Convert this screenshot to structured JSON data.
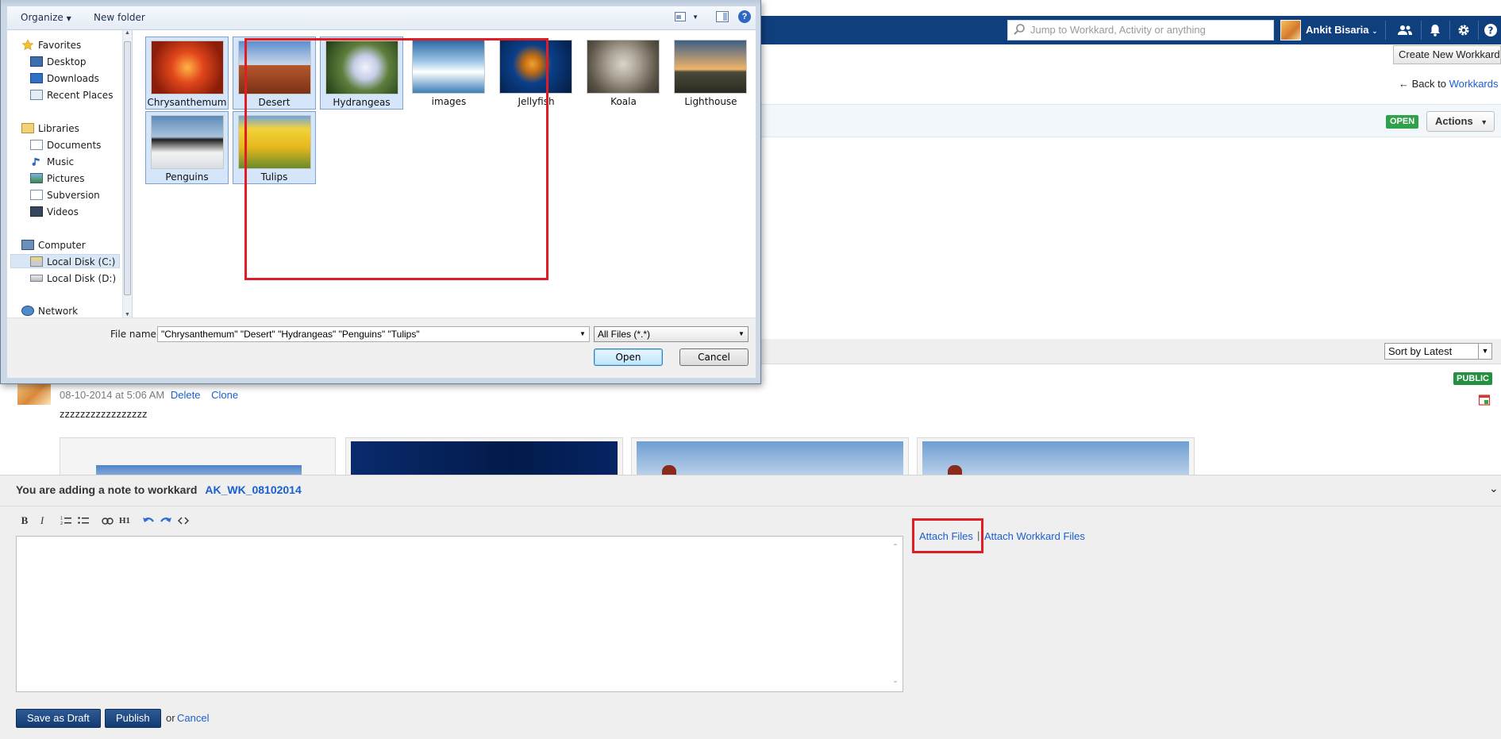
{
  "app": {
    "search_placeholder": "Jump to Workkard, Activity or anything",
    "user_name": "Ankit Bisaria",
    "create_button": "Create New Workkard",
    "back_prefix": "← Back to",
    "back_link": "Workkards",
    "status_open": "OPEN",
    "actions_label": "Actions",
    "sort_selected": "Sort by Latest"
  },
  "post": {
    "timestamp": "08-10-2014 at 5:06 AM",
    "delete_link": "Delete",
    "clone_link": "Clone",
    "body": "zzzzzzzzzzzzzzzzz",
    "visibility": "PUBLIC"
  },
  "note": {
    "title_prefix": "You are adding a note to workkard",
    "workkard_id": "AK_WK_08102014",
    "attach_files": "Attach Files",
    "separator": "|",
    "attach_workkard_files": "Attach Workkard Files",
    "save_draft": "Save as Draft",
    "publish": "Publish",
    "or_text": "or",
    "cancel": "Cancel",
    "toolbar": [
      "B",
      "I",
      "H1"
    ]
  },
  "dialog": {
    "organize": "Organize",
    "new_folder": "New folder",
    "nav": {
      "favorites": "Favorites",
      "desktop": "Desktop",
      "downloads": "Downloads",
      "recent_places": "Recent Places",
      "libraries": "Libraries",
      "documents": "Documents",
      "music": "Music",
      "pictures": "Pictures",
      "subversion": "Subversion",
      "videos": "Videos",
      "computer": "Computer",
      "local_c": "Local Disk (C:)",
      "local_d": "Local Disk (D:)",
      "network": "Network"
    },
    "files": [
      {
        "name": "Chrysanthemum",
        "selected": true,
        "color": "#e2481b"
      },
      {
        "name": "Desert",
        "selected": true,
        "color": "#b5562b"
      },
      {
        "name": "Hydrangeas",
        "selected": true,
        "color": "#5e7e3c"
      },
      {
        "name": "images",
        "selected": false,
        "color": "#6d9fc4"
      },
      {
        "name": "Jellyfish",
        "selected": false,
        "color": "#0a3f8a"
      },
      {
        "name": "Koala",
        "selected": false,
        "color": "#8c8272"
      },
      {
        "name": "Lighthouse",
        "selected": false,
        "color": "#3e5f86"
      },
      {
        "name": "Penguins",
        "selected": true,
        "color": "#5d8ab8"
      },
      {
        "name": "Tulips",
        "selected": true,
        "color": "#e5b81d"
      }
    ],
    "file_name_label": "File name:",
    "file_name_value": "\"Chrysanthemum\" \"Desert\" \"Hydrangeas\" \"Penguins\" \"Tulips\"",
    "file_type": "All Files (*.*)",
    "open": "Open",
    "cancel": "Cancel"
  }
}
